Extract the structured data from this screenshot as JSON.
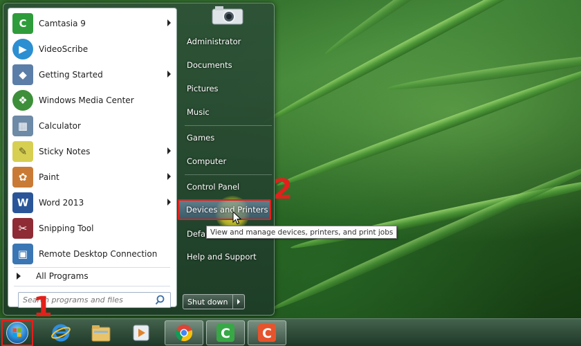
{
  "colors": {
    "accent_red": "#e3201b",
    "highlight": "#e0201a"
  },
  "start_menu": {
    "programs": [
      {
        "label": "Camtasia 9",
        "icon": "camtasia-icon",
        "color": "#2e9c3a",
        "glyph": "C",
        "submenu": true
      },
      {
        "label": "VideoScribe",
        "icon": "videoscribe-icon",
        "color": "#2b8fd2",
        "glyph": "▶",
        "submenu": false
      },
      {
        "label": "Getting Started",
        "icon": "getting-started-icon",
        "color": "#5b7ea8",
        "glyph": "◆",
        "submenu": true
      },
      {
        "label": "Windows Media Center",
        "icon": "media-center-icon",
        "color": "#3d8f3a",
        "glyph": "❖",
        "submenu": false
      },
      {
        "label": "Calculator",
        "icon": "calculator-icon",
        "color": "#6d8aa6",
        "glyph": "▦",
        "submenu": false
      },
      {
        "label": "Sticky Notes",
        "icon": "sticky-notes-icon",
        "color": "#d7cf52",
        "glyph": "✎",
        "submenu": true
      },
      {
        "label": "Paint",
        "icon": "paint-icon",
        "color": "#c97b35",
        "glyph": "✿",
        "submenu": true
      },
      {
        "label": "Word 2013",
        "icon": "word-icon",
        "color": "#2a5699",
        "glyph": "W",
        "submenu": true
      },
      {
        "label": "Snipping Tool",
        "icon": "scissors-icon",
        "color": "#8e2b35",
        "glyph": "✂",
        "submenu": false
      },
      {
        "label": "Remote Desktop Connection",
        "icon": "remote-desktop-icon",
        "color": "#3a76b4",
        "glyph": "▣",
        "submenu": false
      }
    ],
    "all_programs": "All Programs",
    "search_placeholder": "Search programs and files",
    "right_items": [
      {
        "label": "Administrator"
      },
      {
        "label": "Documents"
      },
      {
        "label": "Pictures"
      },
      {
        "label": "Music"
      },
      {
        "label": "Games"
      },
      {
        "label": "Computer"
      },
      {
        "label": "Control Panel"
      },
      {
        "label": "Devices and Printers"
      },
      {
        "label": "Defau"
      },
      {
        "label": "Help and Support"
      }
    ],
    "shutdown_label": "Shut down"
  },
  "tooltip": "View and manage devices, printers, and print jobs",
  "step_markers": {
    "start": "1",
    "devices": "2"
  },
  "taskbar": {
    "items": [
      {
        "icon": "internet-explorer-icon"
      },
      {
        "icon": "file-explorer-icon"
      },
      {
        "icon": "media-player-icon"
      },
      {
        "icon": "chrome-icon"
      },
      {
        "icon": "camtasia-icon"
      },
      {
        "icon": "camtasia-recorder-icon"
      }
    ]
  }
}
